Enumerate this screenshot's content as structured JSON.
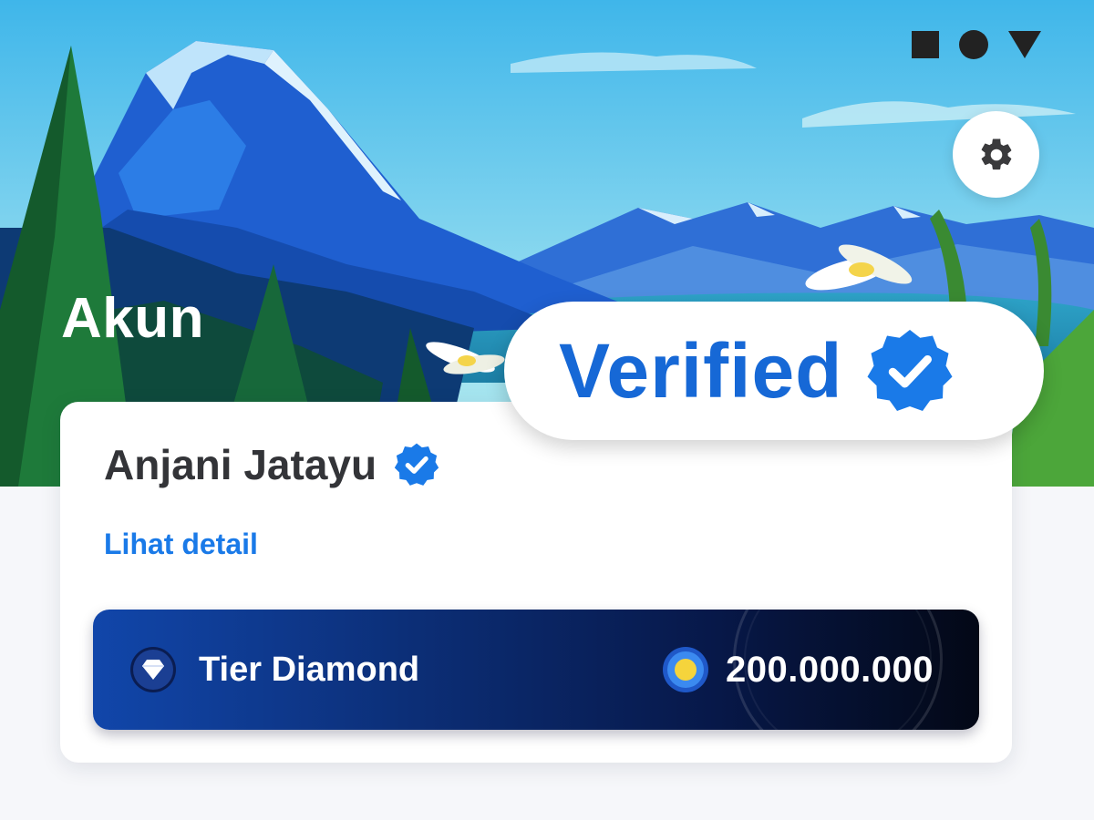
{
  "header": {
    "title": "Akun",
    "settings_icon": "gear-icon",
    "system_icons": [
      "square-icon",
      "circle-icon",
      "triangle-icon"
    ]
  },
  "profile": {
    "name": "Anjani Jatayu",
    "verified_icon": "verified-badge-icon",
    "detail_link": "Lihat detail"
  },
  "tier": {
    "label": "Tier Diamond",
    "icon": "diamond-icon",
    "points": "200.000.000",
    "points_icon": "coin-icon"
  },
  "badge": {
    "text": "Verified",
    "icon": "verified-badge-icon"
  },
  "colors": {
    "accent": "#1a7ae8",
    "verified_blue": "#1668d6",
    "tier_gradient_start": "#1146aa",
    "tier_gradient_end": "#030816",
    "coin": "#f5d43c"
  }
}
